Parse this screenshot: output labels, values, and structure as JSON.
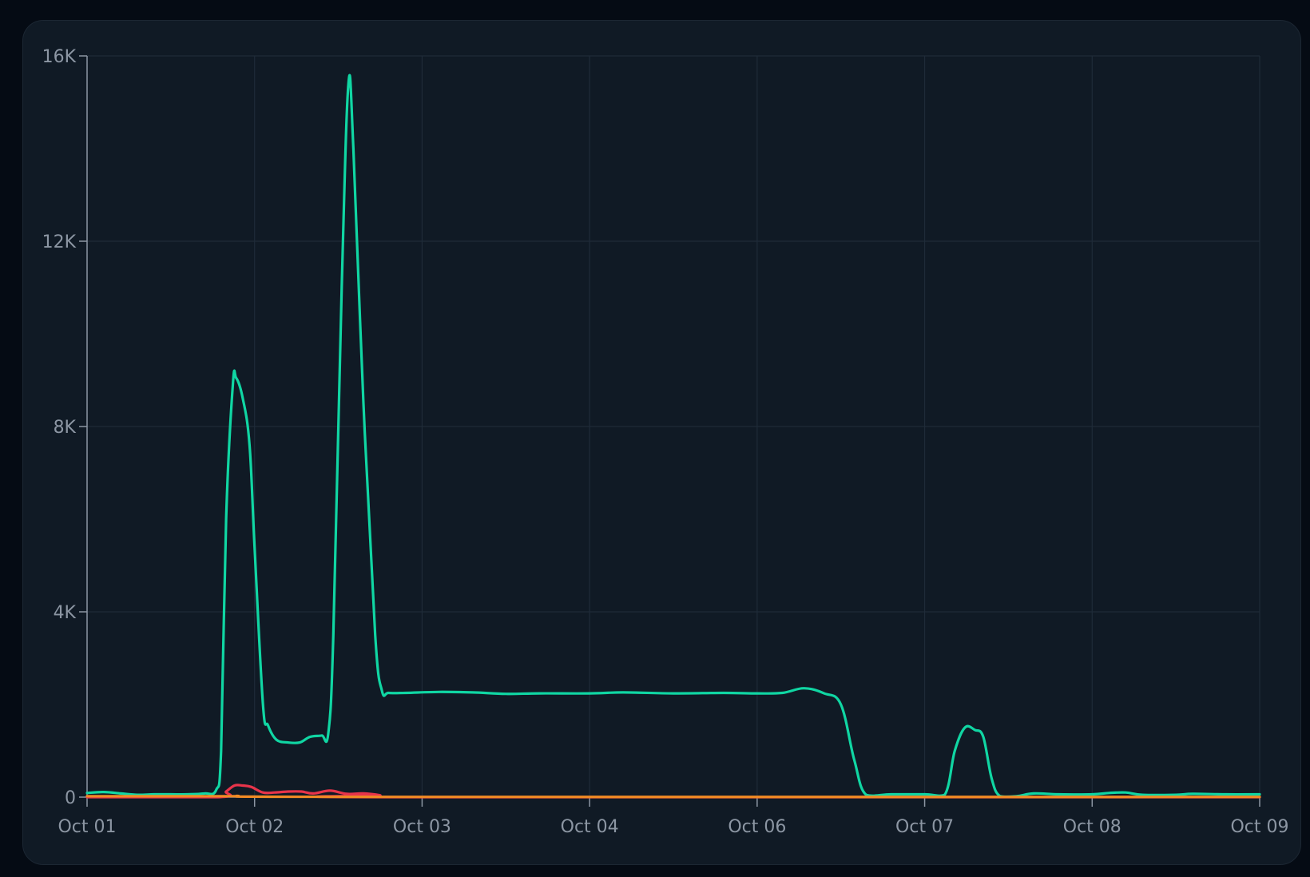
{
  "chart_data": {
    "type": "line",
    "x_tick_labels": [
      "Oct 01",
      "Oct 02",
      "Oct 03",
      "Oct 04",
      "Oct 06",
      "Oct 07",
      "Oct 08",
      "Oct 09"
    ],
    "y_tick_labels": [
      "0",
      "4K",
      "8K",
      "12K",
      "16K"
    ],
    "ylim": [
      0,
      16000
    ],
    "xlim": [
      0,
      7
    ],
    "grid": true,
    "legend": "none",
    "series": [
      {
        "color": "#10d6a3",
        "points": [
          [
            0,
            90
          ],
          [
            0.1,
            110
          ],
          [
            0.2,
            80
          ],
          [
            0.3,
            50
          ],
          [
            0.4,
            60
          ],
          [
            0.5,
            60
          ],
          [
            0.6,
            60
          ],
          [
            0.7,
            80
          ],
          [
            0.77,
            150
          ],
          [
            0.8,
            1000
          ],
          [
            0.83,
            6000
          ],
          [
            0.87,
            8900
          ],
          [
            0.89,
            9050
          ],
          [
            0.93,
            8600
          ],
          [
            0.97,
            7600
          ],
          [
            1.0,
            5400
          ],
          [
            1.05,
            2000
          ],
          [
            1.08,
            1550
          ],
          [
            1.13,
            1240
          ],
          [
            1.2,
            1180
          ],
          [
            1.27,
            1180
          ],
          [
            1.33,
            1300
          ],
          [
            1.4,
            1330
          ],
          [
            1.44,
            1380
          ],
          [
            1.47,
            3500
          ],
          [
            1.52,
            11000
          ],
          [
            1.56,
            15400
          ],
          [
            1.59,
            14000
          ],
          [
            1.65,
            8500
          ],
          [
            1.72,
            3500
          ],
          [
            1.76,
            2300
          ],
          [
            1.8,
            2250
          ],
          [
            1.9,
            2250
          ],
          [
            2.1,
            2270
          ],
          [
            2.3,
            2260
          ],
          [
            2.5,
            2230
          ],
          [
            2.7,
            2240
          ],
          [
            3.0,
            2240
          ],
          [
            3.2,
            2260
          ],
          [
            3.5,
            2240
          ],
          [
            3.8,
            2250
          ],
          [
            4.0,
            2240
          ],
          [
            4.15,
            2250
          ],
          [
            4.28,
            2350
          ],
          [
            4.4,
            2240
          ],
          [
            4.5,
            2000
          ],
          [
            4.58,
            800
          ],
          [
            4.65,
            50
          ],
          [
            4.8,
            60
          ],
          [
            5.0,
            60
          ],
          [
            5.12,
            50
          ],
          [
            5.18,
            1000
          ],
          [
            5.24,
            1500
          ],
          [
            5.3,
            1450
          ],
          [
            5.35,
            1300
          ],
          [
            5.4,
            400
          ],
          [
            5.45,
            20
          ],
          [
            5.55,
            20
          ],
          [
            5.65,
            80
          ],
          [
            5.8,
            60
          ],
          [
            6.0,
            60
          ],
          [
            6.1,
            90
          ],
          [
            6.2,
            100
          ],
          [
            6.3,
            50
          ],
          [
            6.5,
            50
          ],
          [
            6.6,
            70
          ],
          [
            6.8,
            60
          ],
          [
            7.0,
            60
          ]
        ]
      },
      {
        "color": "#e8344a",
        "points": [
          [
            0,
            0
          ],
          [
            0.78,
            0
          ],
          [
            0.83,
            120
          ],
          [
            0.88,
            250
          ],
          [
            0.93,
            250
          ],
          [
            0.98,
            220
          ],
          [
            1.05,
            100
          ],
          [
            1.12,
            100
          ],
          [
            1.2,
            120
          ],
          [
            1.28,
            120
          ],
          [
            1.35,
            80
          ],
          [
            1.45,
            140
          ],
          [
            1.55,
            70
          ],
          [
            1.65,
            80
          ],
          [
            1.75,
            40
          ],
          [
            1.8,
            0
          ],
          [
            7.0,
            0
          ]
        ]
      },
      {
        "color": "#f08a24",
        "points": [
          [
            0,
            20
          ],
          [
            0.8,
            20
          ],
          [
            0.9,
            25
          ],
          [
            1.0,
            10
          ],
          [
            2.0,
            5
          ],
          [
            7.0,
            5
          ]
        ]
      }
    ]
  }
}
